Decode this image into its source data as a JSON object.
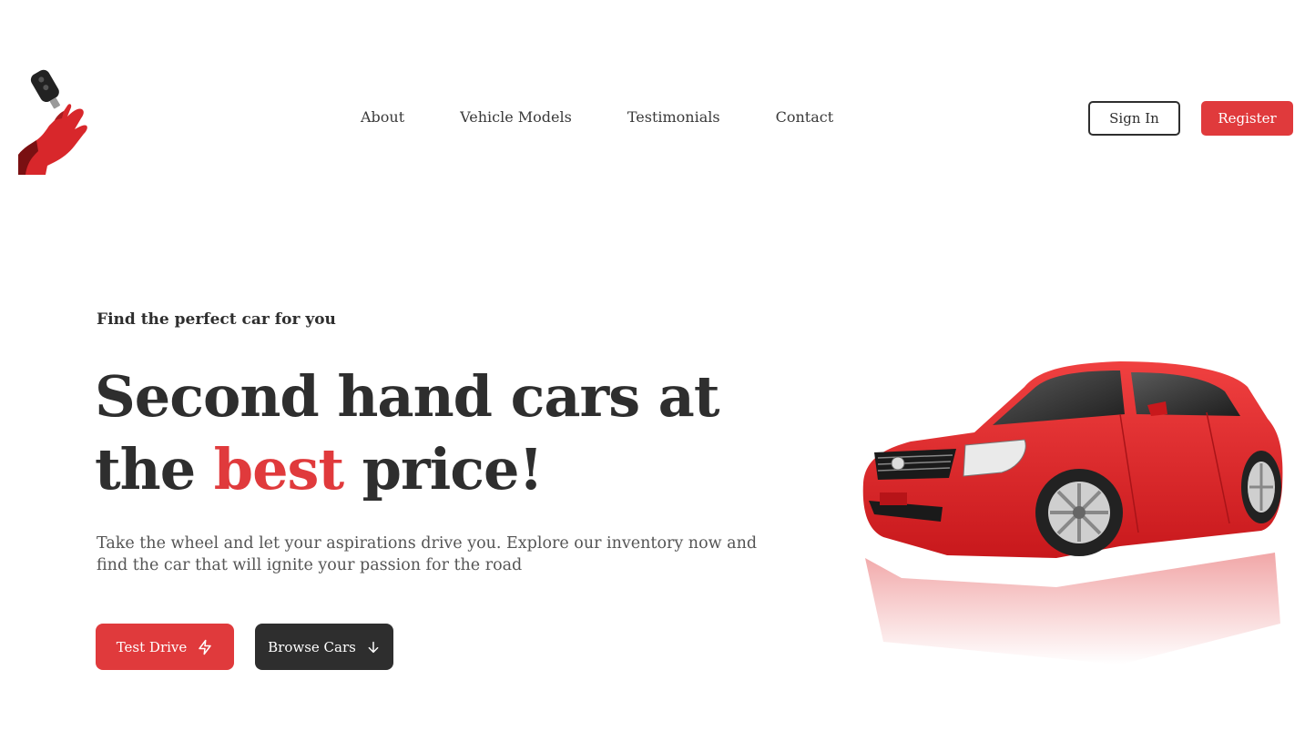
{
  "header": {
    "logo_icon": "hand-with-car-key-icon",
    "nav": [
      {
        "label": "About"
      },
      {
        "label": "Vehicle Models"
      },
      {
        "label": "Testimonials"
      },
      {
        "label": "Contact"
      }
    ],
    "sign_in_label": "Sign In",
    "register_label": "Register"
  },
  "hero": {
    "eyebrow": "Find the perfect car for you",
    "headline_line1": "Second hand cars at",
    "headline_pre": "the ",
    "headline_accent": "best",
    "headline_post": " price!",
    "description": "Take the wheel and let your aspirations drive you. Explore our inventory now and find the car that will ignite your passion for the road",
    "test_drive_label": "Test Drive",
    "test_drive_icon": "lightning-icon",
    "browse_label": "Browse Cars",
    "browse_icon": "arrow-down-icon",
    "image_icon": "red-sedan-car-image"
  },
  "colors": {
    "accent": "#e03a3c",
    "dark": "#2e2e2e",
    "text_muted": "#555555",
    "background": "#ffffff"
  }
}
